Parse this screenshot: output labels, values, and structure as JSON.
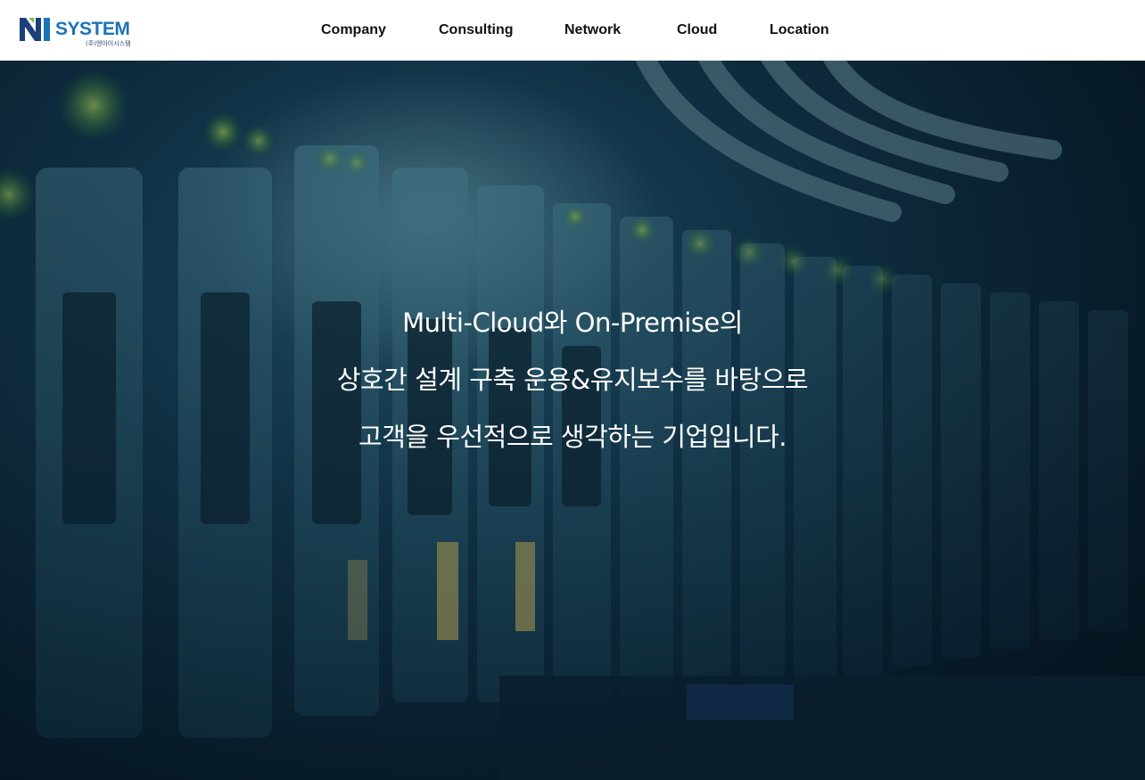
{
  "brand": {
    "name": "SYSTEM",
    "mark": "NI",
    "subtitle": "(주)엔아이시스템",
    "colors": {
      "mark_dark": "#1b3f7a",
      "mark_green": "#79c043",
      "word": "#1b73b8"
    }
  },
  "nav": {
    "items": [
      {
        "label": "Company"
      },
      {
        "label": "Consulting"
      },
      {
        "label": "Network"
      },
      {
        "label": "Cloud"
      },
      {
        "label": "Location"
      }
    ]
  },
  "hero": {
    "line1": "Multi-Cloud와 On-Premise의",
    "line2": "상호간 설계 구축 운용&유지보수를 바탕으로",
    "line3": "고객을 우선적으로 생각하는 기업입니다.",
    "background": "server-rack-photo"
  }
}
